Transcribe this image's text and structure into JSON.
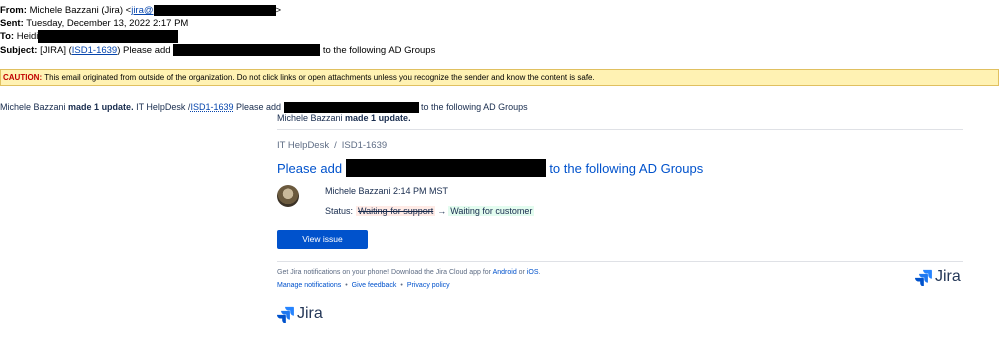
{
  "email": {
    "from_label": "From:",
    "from_name": "Michele Bazzani (Jira) <",
    "from_email_start": "jira@",
    "from_end": ">",
    "sent_label": "Sent:",
    "sent_value": "Tuesday, December 13, 2022 2:17 PM",
    "to_label": "To:",
    "to_value": "Heidi",
    "subject_label": "Subject:",
    "subject_prefix": "[JIRA] (",
    "subject_issue": "ISD1-1639",
    "subject_mid": ") Please add",
    "subject_end": "to the following AD Groups"
  },
  "caution": {
    "label": "CAUTION:",
    "text": " This email originated from outside of the organization. Do not click links or open attachments unless you recognize the sender and know the content is safe."
  },
  "update_line": {
    "name": "Michele Bazzani ",
    "action": "made 1 update.",
    "project": " IT HelpDesk /",
    "issue": "ISD1-1639",
    "text_start": " Please add",
    "text_end": "to the following AD Groups"
  },
  "card": {
    "made_name": "Michele Bazzani ",
    "made_action": "made 1 update.",
    "breadcrumb_project": "IT HelpDesk",
    "breadcrumb_sep": "/",
    "breadcrumb_issue": "ISD1-1639",
    "title_start": "Please add",
    "title_end": "to the following AD Groups",
    "author_time": "Michele Bazzani 2:14 PM MST",
    "status_label": "Status:",
    "status_old": "Waiting for support",
    "status_arrow": "→",
    "status_new": "Waiting for customer",
    "view_button": "View issue",
    "footer_text": "Get Jira notifications on your phone! Download the Jira Cloud app for ",
    "footer_android": "Android",
    "footer_or": " or ",
    "footer_ios": "iOS",
    "footer_period": ".",
    "manage": "Manage notifications",
    "feedback": "Give feedback",
    "privacy": "Privacy policy",
    "bullet": "•"
  },
  "brand": {
    "jira_word": "Jira",
    "jira_color": "#2684ff"
  }
}
